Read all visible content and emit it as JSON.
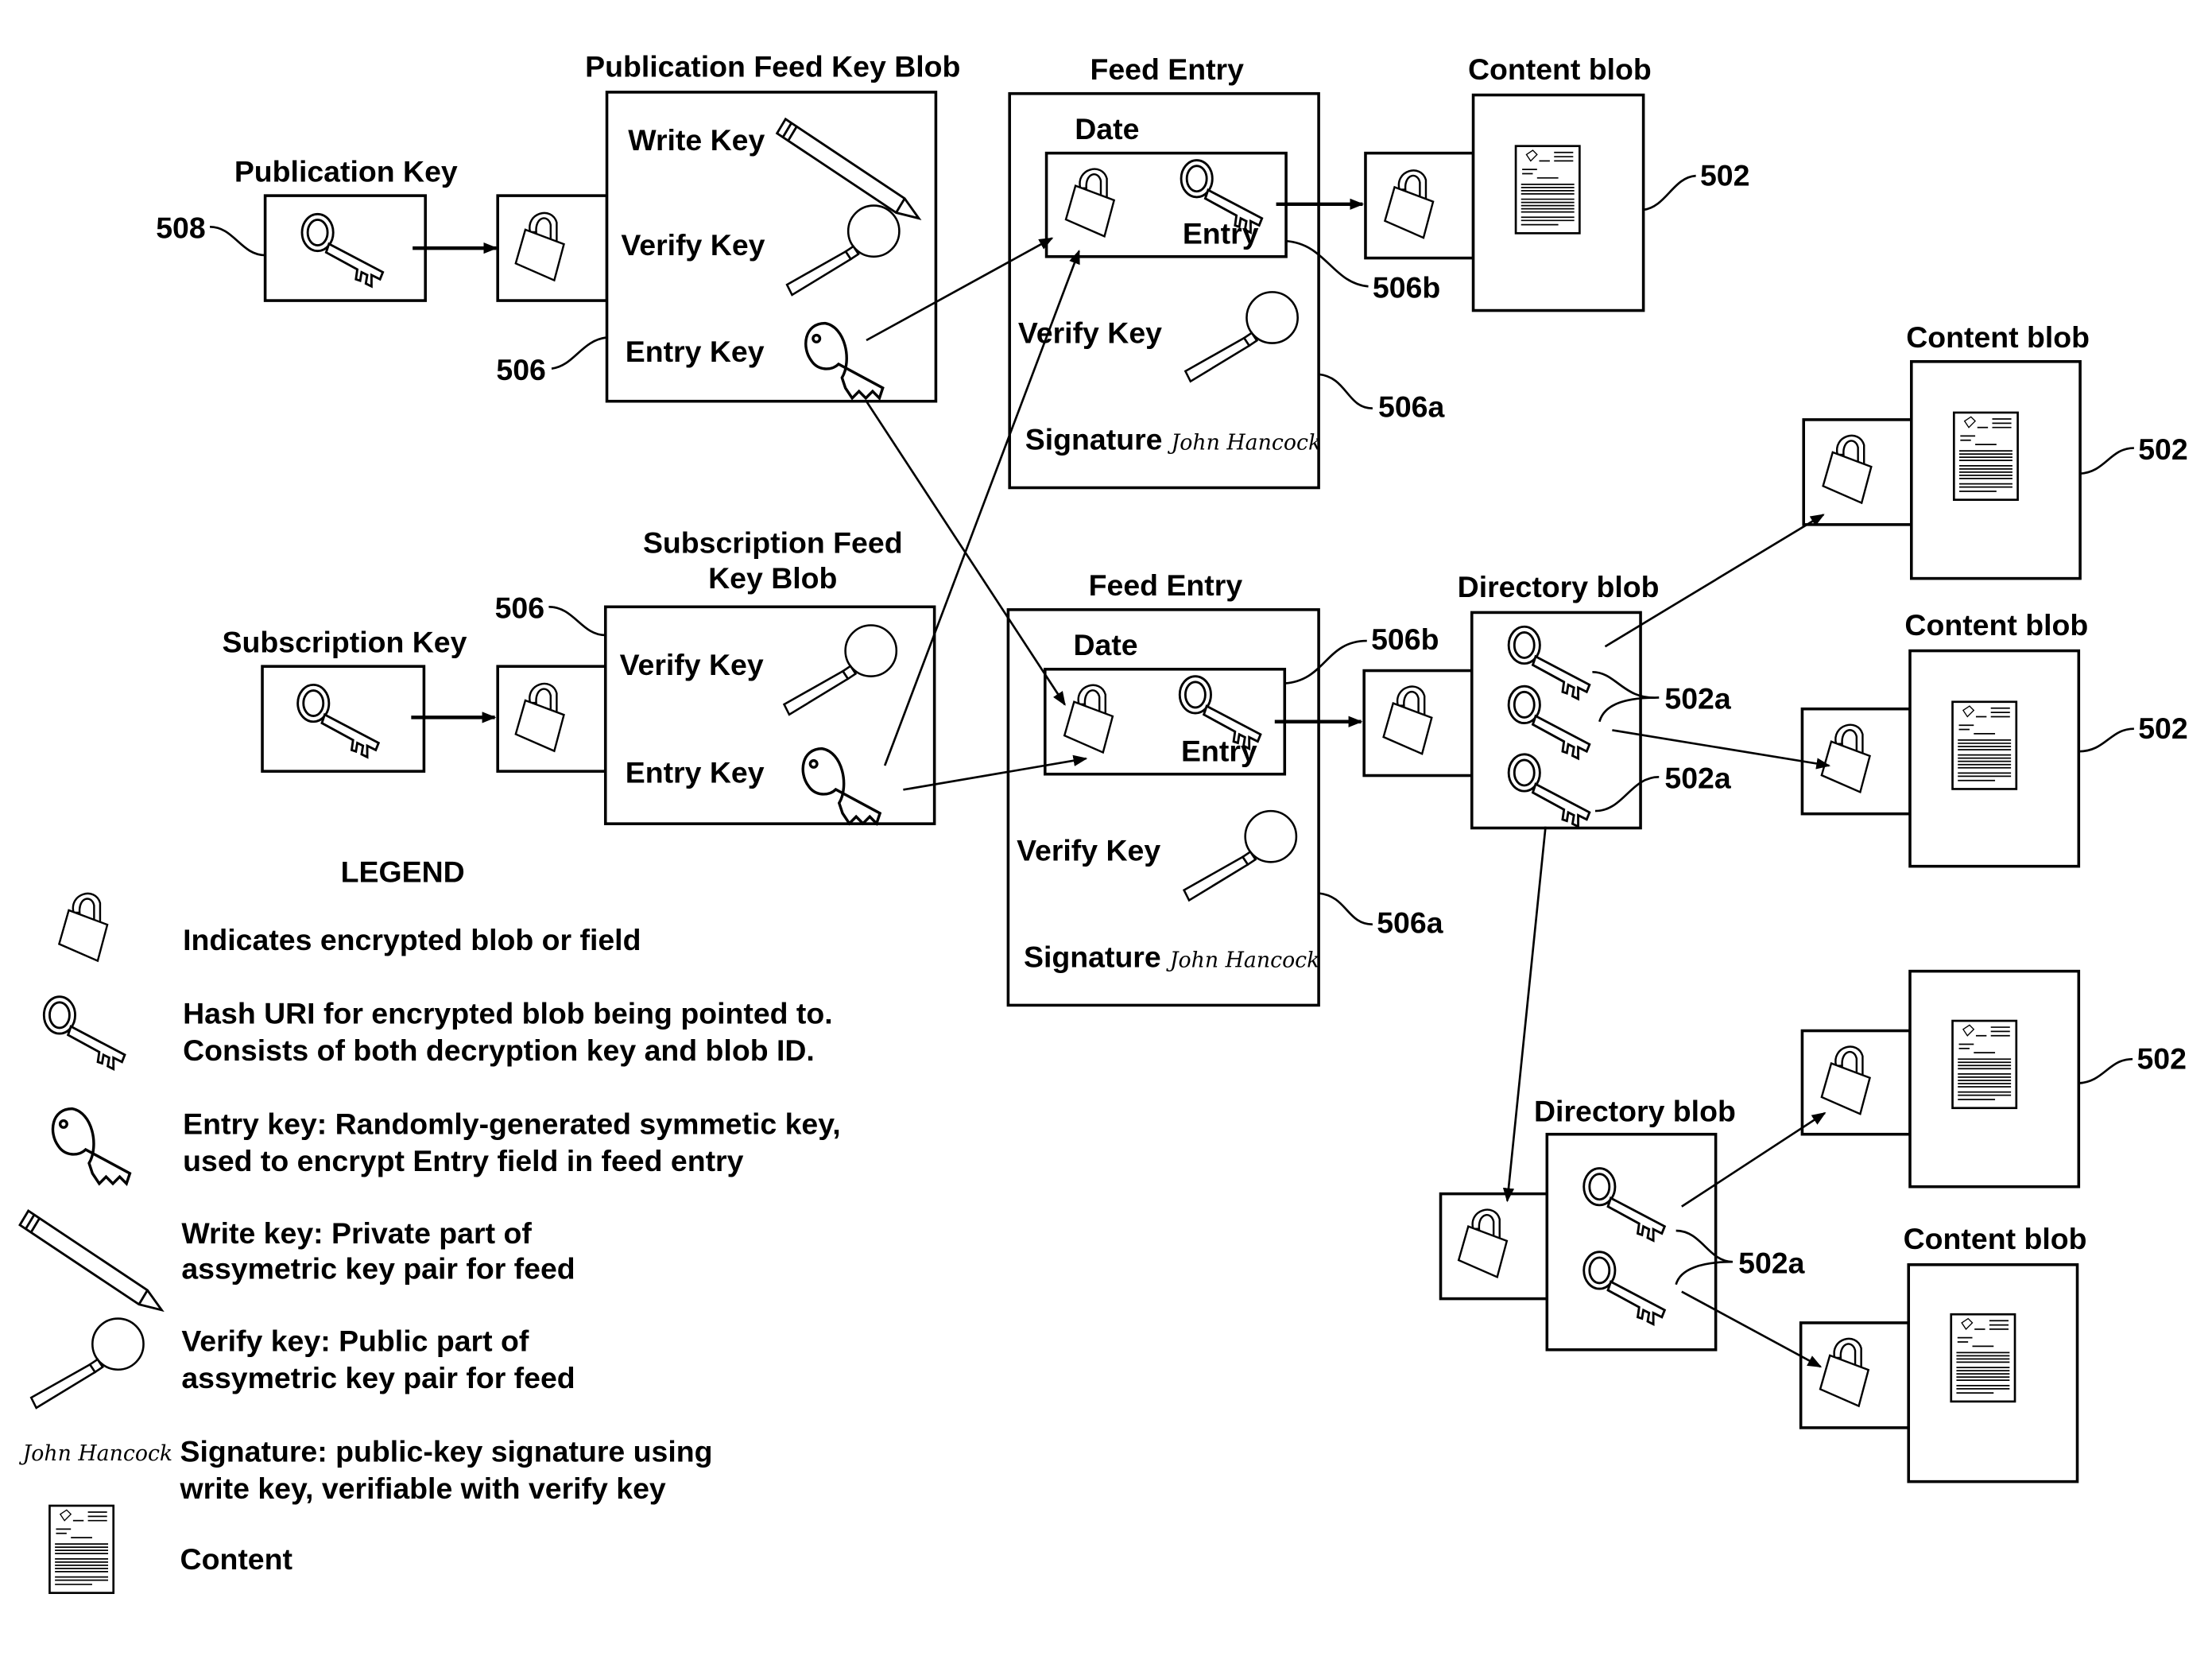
{
  "figure": {
    "publication_key": {
      "title": "Publication Key",
      "ref": "508"
    },
    "publication_feed_key_blob": {
      "title": "Publication Feed Key Blob",
      "ref": "506",
      "fields": [
        "Write Key",
        "Verify Key",
        "Entry Key"
      ]
    },
    "subscription_key": {
      "title": "Subscription Key"
    },
    "subscription_feed_key_blob": {
      "title_line1": "Subscription Feed",
      "title_line2": "Key Blob",
      "ref": "506",
      "fields": [
        "Verify Key",
        "Entry Key"
      ]
    },
    "feed_entries": [
      {
        "title": "Feed Entry",
        "date_label": "Date",
        "entry_label": "Entry",
        "verify_label": "Verify Key",
        "signature_label": "Signature",
        "signature_text": "John Hancock",
        "ref_entry": "506b",
        "ref_box": "506a"
      },
      {
        "title": "Feed Entry",
        "date_label": "Date",
        "entry_label": "Entry",
        "verify_label": "Verify Key",
        "signature_label": "Signature",
        "signature_text": "John Hancock",
        "ref_entry": "506b",
        "ref_box": "506a"
      }
    ],
    "content_blobs": [
      {
        "title": "Content blob",
        "ref": "502"
      },
      {
        "title": "Content blob",
        "ref": "502"
      },
      {
        "title": "Content blob",
        "ref": "502"
      },
      {
        "title": "",
        "ref": "502"
      },
      {
        "title": "Content blob",
        "ref": ""
      }
    ],
    "directory_blobs": [
      {
        "title": "Directory blob",
        "refs": [
          "502a",
          "502a"
        ]
      },
      {
        "title": "Directory blob",
        "refs": [
          "502a"
        ]
      }
    ]
  },
  "legend": {
    "title": "LEGEND",
    "items": [
      {
        "icon": "padlock-icon",
        "lines": [
          "Indicates encrypted blob or field"
        ]
      },
      {
        "icon": "hash-uri-key-icon",
        "lines": [
          "Hash URI for encrypted blob being pointed to.",
          "Consists of both decryption key and blob ID."
        ]
      },
      {
        "icon": "entry-key-icon",
        "lines": [
          "Entry key: Randomly-generated symmetic key,",
          "used to encrypt Entry field in feed entry"
        ]
      },
      {
        "icon": "pen-write-key-icon",
        "lines": [
          "Write key: Private part of",
          "assymetric key pair for feed"
        ]
      },
      {
        "icon": "magnifier-verify-key-icon",
        "lines": [
          "Verify key: Public part of",
          "assymetric key pair for feed"
        ]
      },
      {
        "icon": "signature-icon",
        "lines": [
          "Signature: public-key signature using",
          "write key, verifiable with verify key"
        ]
      },
      {
        "icon": "content-document-icon",
        "lines": [
          "Content"
        ]
      }
    ]
  }
}
